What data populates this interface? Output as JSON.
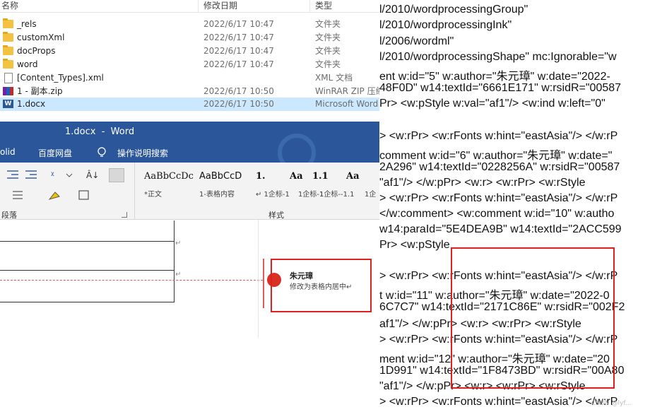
{
  "explorer": {
    "columns": {
      "name": "名称",
      "date": "修改日期",
      "type": "类型"
    },
    "files": [
      {
        "name": "_rels",
        "date": "2022/6/17 10:47",
        "type": "文件夹",
        "icon": "folder-icon"
      },
      {
        "name": "customXml",
        "date": "2022/6/17 10:47",
        "type": "文件夹",
        "icon": "folder-icon"
      },
      {
        "name": "docProps",
        "date": "2022/6/17 10:47",
        "type": "文件夹",
        "icon": "folder-icon"
      },
      {
        "name": "word",
        "date": "2022/6/17 10:47",
        "type": "文件夹",
        "icon": "folder-icon"
      },
      {
        "name": "[Content_Types].xml",
        "date": "",
        "type": "XML 文档",
        "icon": "xml-file-icon"
      },
      {
        "name": "1 - 副本.zip",
        "date": "2022/6/17 10:50",
        "type": "WinRAR ZIP 压缩",
        "icon": "winrar-zip-icon"
      },
      {
        "name": "1.docx",
        "date": "2022/6/17 10:50",
        "type": "Microsoft Word",
        "icon": "word-doc-icon"
      }
    ]
  },
  "word": {
    "title": "1.docx  -  Word",
    "tabs": {
      "t1": "olid",
      "t2": "百度网盘",
      "t3": "操作说明搜索"
    },
    "groups": {
      "paragraph": "段落",
      "styles": "样式"
    },
    "styles": [
      {
        "preview": "AaBbCcDc",
        "label": "*正文"
      },
      {
        "preview": "AaBbCcD",
        "label": "1-表格内容"
      },
      {
        "preview": "1.",
        "label": "↵ 1企标-1"
      },
      {
        "preview": "Aa",
        "label": "1企标-1"
      },
      {
        "preview": "1.1",
        "label": "1企标--1.1"
      },
      {
        "preview": "Aa",
        "label": "1企"
      }
    ],
    "comment": {
      "author": "朱元璋",
      "text": "修改为表格内居中↵"
    }
  },
  "xml_lines": [
    "l/2010/wordprocessingGroup\"",
    "l/2010/wordprocessingInk\"",
    "l/2006/wordml\"",
    "l/2010/wordprocessingShape\" mc:Ignorable=\"w",
    "ent w:id=\"5\" w:author=\"朱元璋\" w:date=\"2022-",
    "48F0D\" w14:textId=\"6661E171\" w:rsidR=\"00587",
    "Pr> <w:pStyle w:val=\"af1\"/> <w:ind w:left=\"0\"",
    "",
    "> <w:rPr> <w:rFonts w:hint=\"eastAsia\"/> </w:rP",
    "comment w:id=\"6\" w:author=\"朱元璋\" w:date=\"",
    "2A296\" w14:textId=\"0228256A\" w:rsidR=\"00587",
    "\"af1\"/> </w:pPr> <w:r> <w:rPr> <w:rStyle",
    "> <w:rPr> <w:rFonts w:hint=\"eastAsia\"/> </w:rP",
    "</w:comment> <w:comment w:id=\"10\" w:autho",
    "w14:paraId=\"5E4DEA9B\" w14:textId=\"2ACC599",
    "Pr> <w:pStyle",
    "",
    "> <w:rPr> <w:rFonts w:hint=\"eastAsia\"/> </w:rP",
    "t w:id=\"11\" w:author=\"朱元璋\" w:date=\"2022-0",
    "6C7C7\" w14:textId=\"2171C86E\" w:rsidR=\"002F2",
    "af1\"/> </w:pPr> <w:r> <w:rPr> <w:rStyle",
    "> <w:rPr> <w:rFonts w:hint=\"eastAsia\"/> </w:rP",
    "ment w:id=\"12\" w:author=\"朱元璋\" w:date=\"20",
    "1D991\" w14:textId=\"1F8473BD\" w:rsidR=\"00A80",
    "\"af1\"/> </w:pPr> <w:r> <w:rPr> <w:rStyle",
    "> <w:rPr> <w:rFonts w:hint=\"eastAsia\"/> </w:rP"
  ],
  "watermark": "CSDN @lyf..."
}
